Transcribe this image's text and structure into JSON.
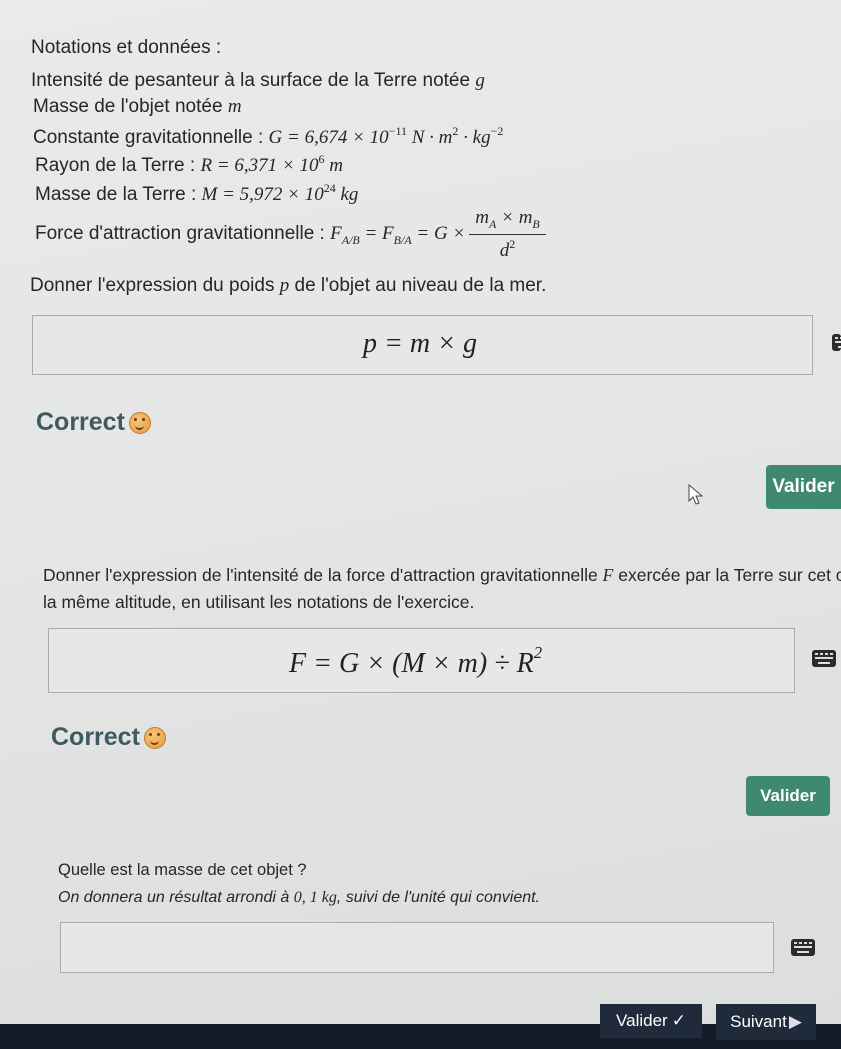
{
  "notations": {
    "heading": "Notations et données :",
    "gravity_label": "Intensité de pesanteur à la surface de la Terre notée",
    "gravity_symbol": "g",
    "mass_label": "Masse de l'objet notée",
    "mass_symbol": "m",
    "G_label": "Constante gravitationnelle :",
    "G_lhs": "G = 6,674 × 10",
    "G_exp": "−11",
    "G_units": "N · m",
    "G_units_exp1": "2",
    "G_units_mid": " · kg",
    "G_units_exp2": "−2",
    "R_label": "Rayon de la Terre :",
    "R_lhs": "R = 6,371 × 10",
    "R_exp": "6",
    "R_unit": "m",
    "M_label": "Masse de la Terre :",
    "M_lhs": "M = 5,972 × 10",
    "M_exp": "24",
    "M_unit": "kg",
    "F_label": "Force d'attraction gravitationnelle :",
    "F_F": "F",
    "F_sub1": "A/B",
    "F_eq": " = F",
    "F_sub2": "B/A",
    "F_G": " = G ×",
    "F_num_a": "m",
    "F_num_a_sub": "A",
    "F_num_x": " × m",
    "F_num_b_sub": "B",
    "F_den": "d",
    "F_den_exp": "2"
  },
  "q1": {
    "prompt_a": "Donner l'expression du poids",
    "prompt_sym": "p",
    "prompt_b": "de l'objet au niveau de la mer.",
    "answer": "p = m × g",
    "feedback": "Correct",
    "button": "Valider"
  },
  "q2": {
    "prompt_a": "Donner l'expression de l'intensité de la force d'attraction gravitationnelle",
    "prompt_sym": "F",
    "prompt_b": "exercée par la Terre sur cet objet",
    "prompt_c": "la même altitude, en utilisant les notations de l'exercice.",
    "answer": "F = G × (M × m) ÷ R",
    "answer_exp": "2",
    "feedback": "Correct",
    "button": "Valider"
  },
  "q3": {
    "prompt": "Quelle est la masse de cet objet ?",
    "hint_a": "On donnera un résultat arrondi à",
    "hint_val": "0, 1 kg",
    "hint_b": ", suivi de l'unité qui convient.",
    "answer": ""
  },
  "footer": {
    "validate": "Valider",
    "validate_check": "✓",
    "next": "Suivant",
    "next_arrow": "▶"
  },
  "colors": {
    "green_button": "#3f8a6e",
    "dark_button": "#1f2a3a",
    "correct_text": "#3f5a5f"
  }
}
